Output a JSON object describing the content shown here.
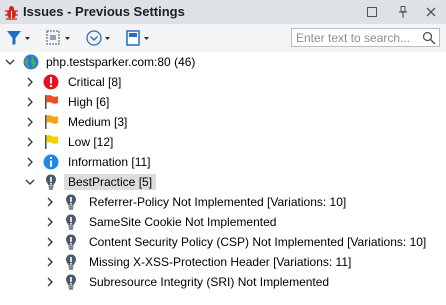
{
  "window": {
    "title": "Issues - Previous Settings"
  },
  "toolbar": {
    "search_placeholder": "Enter text to search..."
  },
  "tree": {
    "root": {
      "label": "php.testsparker.com:80 (46)"
    },
    "groups": [
      {
        "label": "Critical [8]",
        "icon": "critical-icon"
      },
      {
        "label": "High [6]",
        "icon": "high-flag-icon"
      },
      {
        "label": "Medium [3]",
        "icon": "medium-flag-icon"
      },
      {
        "label": "Low [12]",
        "icon": "low-flag-icon"
      },
      {
        "label": "Information [11]",
        "icon": "information-icon"
      },
      {
        "label": "BestPractice [5]",
        "icon": "bestpractice-icon"
      }
    ],
    "bestpractice_items": [
      {
        "label": "Referrer-Policy Not Implemented [Variations: 10]"
      },
      {
        "label": "SameSite Cookie Not Implemented"
      },
      {
        "label": "Content Security Policy (CSP) Not Implemented [Variations: 10]"
      },
      {
        "label": "Missing X-XSS-Protection Header [Variations: 11]"
      },
      {
        "label": "Subresource Integrity (SRI) Not Implemented"
      }
    ]
  },
  "colors": {
    "critical": "#e81123",
    "high": "#f04e23",
    "medium": "#f7a21b",
    "low": "#f5d000",
    "info": "#1e88e5",
    "bestpractice": "#4a5a6a",
    "selected": "#dcdcdc"
  }
}
